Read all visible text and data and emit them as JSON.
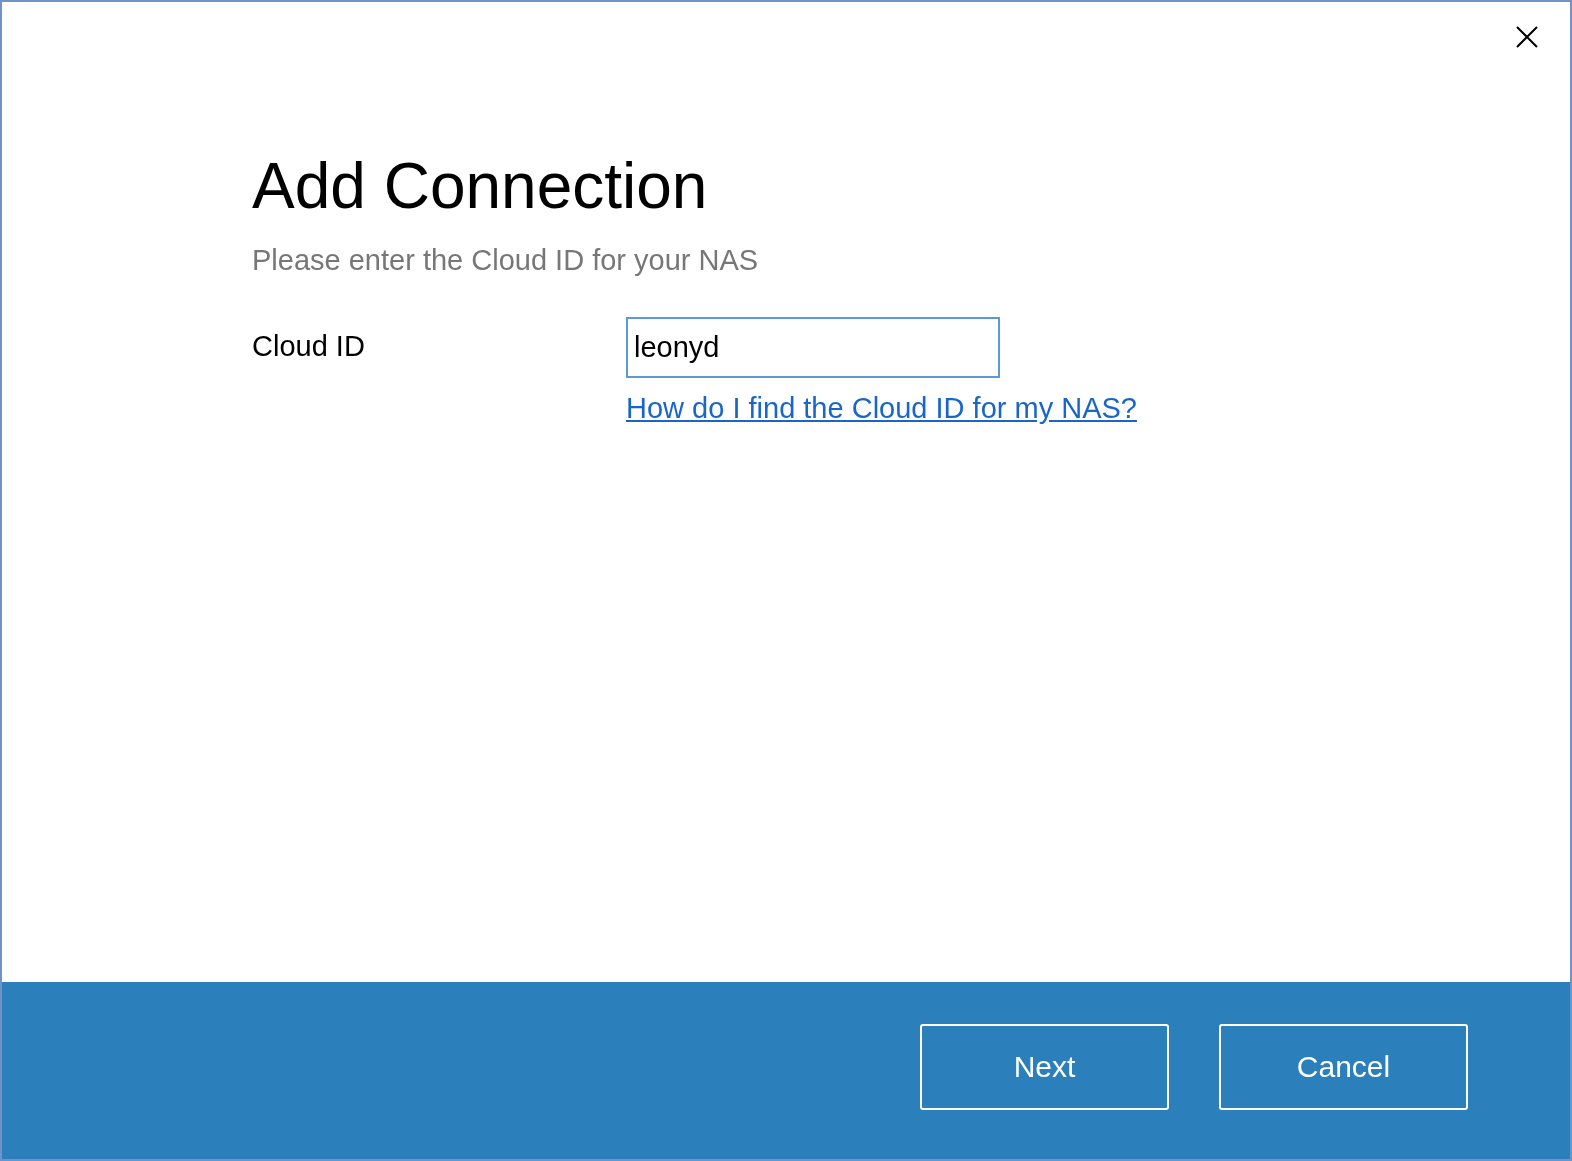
{
  "dialog": {
    "title": "Add Connection",
    "subtitle": "Please enter the Cloud ID for your NAS"
  },
  "form": {
    "label": "Cloud ID",
    "value": "leonyd",
    "help_link": "How do I find the Cloud ID for my NAS?"
  },
  "buttons": [
    "Next",
    "Cancel"
  ]
}
